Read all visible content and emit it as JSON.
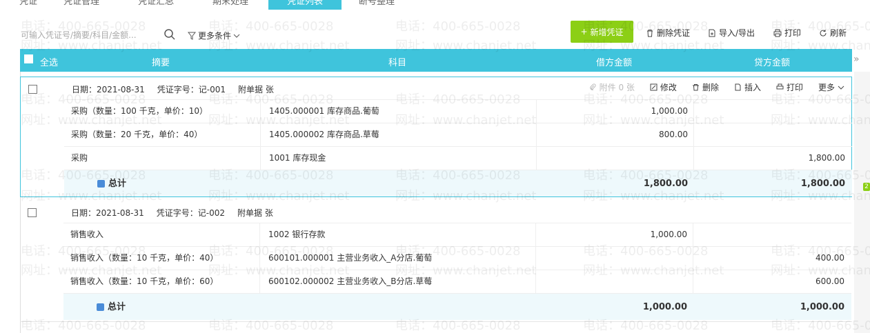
{
  "tabs": [
    {
      "label": "凭证",
      "active": false
    },
    {
      "label": "凭证管理",
      "active": false
    },
    {
      "label": "凭证汇总",
      "active": false
    },
    {
      "label": "期末处理",
      "active": false
    },
    {
      "label": "凭证列表",
      "active": true
    },
    {
      "label": "断号整理",
      "active": false
    }
  ],
  "toolbar": {
    "search_placeholder": "可输入凭证号/摘要/科目/金额...",
    "more_filter": "更多条件",
    "new_voucher": "新增凭证",
    "delete_voucher": "删除凭证",
    "import_export": "导入/导出",
    "print": "打印",
    "refresh": "刷新"
  },
  "header": {
    "select_all": "全选",
    "summary": "摘要",
    "account": "科目",
    "debit": "借方金额",
    "credit": "贷方金额"
  },
  "vouchers": [
    {
      "date": "日期：2021-08-31",
      "number": "凭证字号：记-001",
      "attachments": "附单据  张",
      "actions": {
        "attach": "附件 0 张",
        "edit": "修改",
        "delete": "删除",
        "insert": "插入",
        "print": "打印",
        "more": "更多"
      },
      "rows": [
        {
          "summary": "采购（数量：100 千克，单价：10）",
          "account": "1405.000001  库存商品.葡萄",
          "debit": "1,000.00",
          "credit": ""
        },
        {
          "summary": "采购（数量：20 千克，单价：40）",
          "account": "1405.000002  库存商品.草莓",
          "debit": "800.00",
          "credit": ""
        },
        {
          "summary": "采购",
          "account": "1001 库存现金",
          "debit": "",
          "credit": "1,800.00"
        }
      ],
      "total_label": "总计",
      "total_debit": "1,800.00",
      "total_credit": "1,800.00"
    },
    {
      "date": "日期：2021-08-31",
      "number": "凭证字号：记-002",
      "attachments": "附单据  张",
      "rows": [
        {
          "summary": "销售收入",
          "account": "1002 银行存款",
          "debit": "1,000.00",
          "credit": ""
        },
        {
          "summary": "销售收入（数量：10 千克，单价：40）",
          "account": "600101.000001  主营业务收入_A分店.葡萄",
          "debit": "",
          "credit": "400.00"
        },
        {
          "summary": "销售收入（数量：10 千克，单价：60）",
          "account": "600102.000002  主营业务收入_B分店.草莓",
          "debit": "",
          "credit": "600.00"
        }
      ],
      "total_label": "总计",
      "total_debit": "1,000.00",
      "total_credit": "1,000.00"
    }
  ],
  "watermark": {
    "phone": "电话：400-665-0028",
    "site": "网址：www.chanjet.net"
  },
  "scroll_badge": "2",
  "colors": {
    "header": "#3fc4dc",
    "new_button": "#8ccf16",
    "total_bg": "#eef9fc"
  }
}
